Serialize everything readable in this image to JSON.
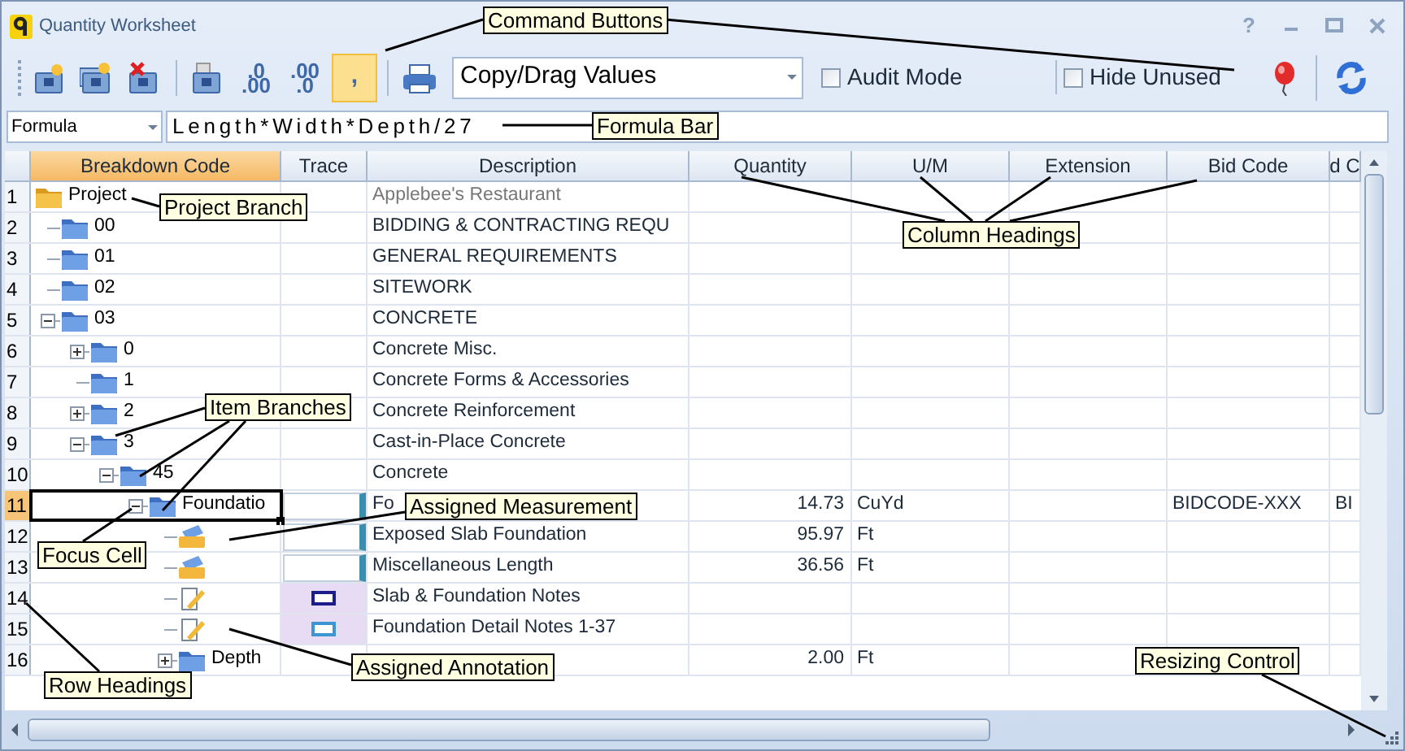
{
  "window": {
    "title": "Quantity Worksheet",
    "help": "?"
  },
  "toolbar": {
    "buttons": [
      {
        "kind": "add-branch",
        "selected": false
      },
      {
        "kind": "add-item",
        "selected": false
      },
      {
        "kind": "delete",
        "selected": false
      },
      {
        "kind": "paste",
        "selected": false
      },
      {
        "kind": "decimal",
        "top": ".0",
        "bottom": ".00",
        "selected": false
      },
      {
        "kind": "decimal",
        "top": ".00",
        "bottom": ".0",
        "selected": false
      },
      {
        "kind": "comma",
        "label": ",",
        "selected": true
      },
      {
        "kind": "print",
        "selected": false
      }
    ],
    "mode_dropdown": {
      "value": "Copy/Drag Values"
    },
    "checkboxes": [
      {
        "label": "Audit Mode",
        "checked": false
      },
      {
        "label": "Hide Unused",
        "checked": false
      }
    ],
    "end_buttons": [
      {
        "kind": "balloon"
      },
      {
        "kind": "refresh"
      }
    ]
  },
  "formula_bar": {
    "field": "Formula",
    "value": "Length*Width*Depth/27"
  },
  "grid": {
    "columns": [
      {
        "label": "Breakdown Code",
        "selected": true
      },
      {
        "label": "Trace",
        "selected": false
      },
      {
        "label": "Description",
        "selected": false
      },
      {
        "label": "Quantity",
        "selected": false
      },
      {
        "label": "U/M",
        "selected": false
      },
      {
        "label": "Extension",
        "selected": false
      },
      {
        "label": "Bid Code",
        "selected": false
      },
      {
        "label": "d C",
        "selected": false
      }
    ],
    "rows": [
      {
        "row": "1",
        "code": "Project",
        "kind": "project",
        "description": "Applebee's Restaurant",
        "selected": false,
        "children": [
          {
            "row": "2",
            "code": "00",
            "kind": "folder",
            "description": "BIDDING & CONTRACTING REQU",
            "selected": false
          },
          {
            "row": "3",
            "code": "01",
            "kind": "folder",
            "description": "GENERAL REQUIREMENTS",
            "selected": false
          },
          {
            "row": "4",
            "code": "02",
            "kind": "folder",
            "description": "SITEWORK",
            "selected": false
          },
          {
            "row": "5",
            "code": "03",
            "kind": "folder",
            "description": "CONCRETE",
            "selected": false,
            "expanded": true,
            "children": [
              {
                "row": "6",
                "code": "0",
                "kind": "folder",
                "description": "Concrete Misc.",
                "selected": false,
                "expanded": false
              },
              {
                "row": "7",
                "code": "1",
                "kind": "folder",
                "description": "Concrete Forms & Accessories",
                "selected": false
              },
              {
                "row": "8",
                "code": "2",
                "kind": "folder",
                "description": "Concrete Reinforcement",
                "selected": false,
                "expanded": false
              },
              {
                "row": "9",
                "code": "3",
                "kind": "folder",
                "description": "Cast-in-Place Concrete",
                "selected": false,
                "expanded": true,
                "children": [
                  {
                    "row": "10",
                    "code": "45",
                    "kind": "folder",
                    "description": "Concrete",
                    "selected": false,
                    "expanded": true,
                    "children": [
                      {
                        "row": "11",
                        "code": "Foundatio",
                        "kind": "folder",
                        "description": "Fo",
                        "trace": {
                          "kind": "measurement"
                        },
                        "quantity": "14.73",
                        "um": "CuYd",
                        "bid_code": "BIDCODE-XXX",
                        "column_9": "BI",
                        "selected": true,
                        "expanded": true,
                        "children": [
                          {
                            "row": "12",
                            "kind": "measurement",
                            "description": "Exposed Slab Foundation",
                            "trace": {
                              "kind": "measurement"
                            },
                            "quantity": "95.97",
                            "um": "Ft",
                            "selected": false
                          },
                          {
                            "row": "13",
                            "kind": "measurement",
                            "description": "Miscellaneous Length",
                            "trace": {
                              "kind": "measurement"
                            },
                            "quantity": "36.56",
                            "um": "Ft",
                            "selected": false
                          },
                          {
                            "row": "14",
                            "kind": "annotation",
                            "description": "Slab & Foundation Notes",
                            "trace": {
                              "kind": "annotation",
                              "color": "#1c1c8a"
                            },
                            "selected": false
                          },
                          {
                            "row": "15",
                            "kind": "annotation",
                            "description": "Foundation Detail Notes 1-37",
                            "trace": {
                              "kind": "annotation",
                              "color": "#3c96d2"
                            },
                            "selected": false
                          },
                          {
                            "row": "16",
                            "code": "Depth",
                            "kind": "folder",
                            "quantity": "2.00",
                            "um": "Ft",
                            "selected": false,
                            "expanded": false
                          }
                        ]
                      }
                    ]
                  }
                ]
              }
            ]
          }
        ]
      }
    ]
  },
  "callouts": [
    {
      "text": "Command Buttons"
    },
    {
      "text": "Formula Bar"
    },
    {
      "text": "Project Branch"
    },
    {
      "text": "Column Headings"
    },
    {
      "text": "Item Branches"
    },
    {
      "text": "Assigned Measurement"
    },
    {
      "text": "Focus Cell"
    },
    {
      "text": "Row Headings"
    },
    {
      "text": "Assigned Annotation"
    },
    {
      "text": "Resizing Control"
    }
  ]
}
